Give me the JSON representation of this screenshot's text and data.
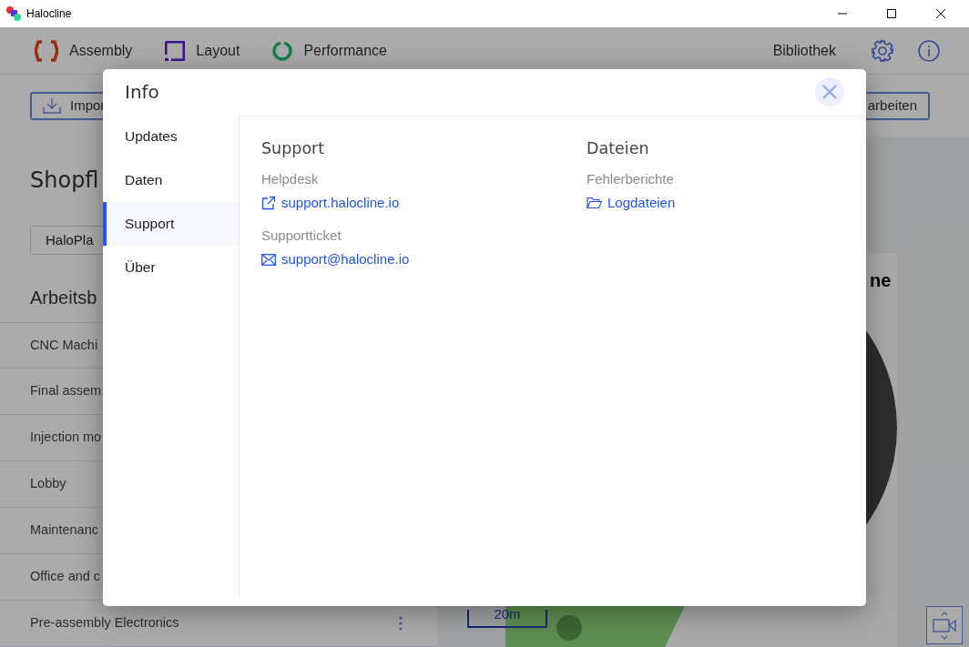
{
  "window": {
    "title": "Halocline"
  },
  "nav": {
    "items": [
      {
        "label": "Assembly",
        "kind": "assembly"
      },
      {
        "label": "Layout",
        "kind": "layout"
      },
      {
        "label": "Performance",
        "kind": "performance"
      }
    ],
    "library": "Bibliothek"
  },
  "toolbar": {
    "import_button": "Impor",
    "edit_button": "arbeiten"
  },
  "panel": {
    "title": "Shopfl",
    "plan_select": "HaloPla",
    "section_title": "Arbeitsb",
    "areas": [
      {
        "label": "CNC Machi"
      },
      {
        "label": "Final assem"
      },
      {
        "label": "Injection mo"
      },
      {
        "label": "Lobby"
      },
      {
        "label": "Maintenanc"
      },
      {
        "label": "Office and c"
      },
      {
        "label": "Pre-assembly Electronics",
        "menu_shown": true
      }
    ]
  },
  "canvas": {
    "card_title": "ne",
    "scale": "20m"
  },
  "dialog": {
    "title": "Info",
    "tabs": [
      {
        "label": "Updates",
        "selected": false
      },
      {
        "label": "Daten",
        "selected": false
      },
      {
        "label": "Support",
        "selected": true
      },
      {
        "label": "Über",
        "selected": false
      }
    ],
    "sections": [
      {
        "title": "Support",
        "entries": [
          {
            "label": "Helpdesk",
            "link": "support.halocline.io",
            "kind": "external"
          },
          {
            "label": "Supportticket",
            "link": "support@halocline.io",
            "kind": "mail"
          }
        ]
      },
      {
        "title": "Dateien",
        "entries": [
          {
            "label": "Fehlerberichte",
            "link": "Logdateien",
            "kind": "folder"
          }
        ]
      }
    ]
  }
}
